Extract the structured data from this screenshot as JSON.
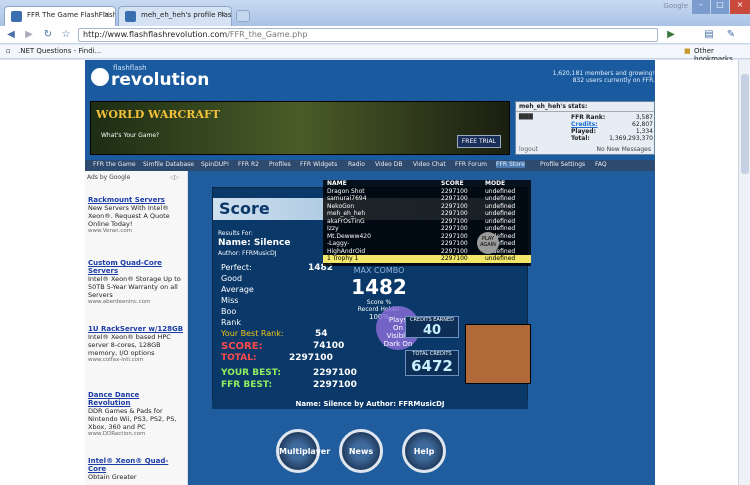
{
  "browser": {
    "tabs": [
      {
        "label": "FFR The Game FlashFlashR..."
      },
      {
        "label": "meh_eh_heh's profile FlashF..."
      }
    ],
    "google_label": "Google",
    "url_host": "http://www.flashflashrevolution.com",
    "url_path": "/FFR_the_Game.php",
    "bookmark": ".NET Questions - Findi...",
    "other_bookmarks": "Other bookmarks"
  },
  "site": {
    "logo_top": "flashflash",
    "logo_main": "revolution",
    "members_line": "1,620,181 members and growing!",
    "online_line": "832 users currently on FFR.",
    "banner_title": "WORLD WARCRAFT",
    "banner_sub": "What's Your Game?",
    "free_trial": "FREE TRIAL"
  },
  "user": {
    "title": "meh_eh_heh's stats:",
    "ffr_rank_label": "FFR Rank:",
    "ffr_rank": "3,587",
    "credits_label": "Credits:",
    "credits": "62,807",
    "played_label": "Played:",
    "played": "1,334",
    "total_label": "Total:",
    "total": "1,369,293,370",
    "logout": "logout",
    "messages": "No New Messages"
  },
  "menu": [
    "FFR the Game",
    "Simfile Database",
    "SpinDUP!",
    "FFR R2",
    "Profiles",
    "FFR Widgets",
    "Radio",
    "Video DB",
    "Video Chat",
    "FFR Forum",
    "FFR Store",
    "Profile Settings",
    "FAQ"
  ],
  "ads": {
    "header": "Ads by Google",
    "items": [
      {
        "title": "Rackmount Servers",
        "text": "New Servers With Intel® Xeon®. Request A Quote Online Today!",
        "url": "www.Veran.com"
      },
      {
        "title": "Custom Quad-Core Servers",
        "text": "Intel® Xeon® Storage Up to 50TB 5-Year Warranty on all Servers",
        "url": "www.aberdeeninc.com"
      },
      {
        "title": "1U RackServer w/128GB",
        "text": "Intel® Xeon® based HPC server 8-cores, 128GB memory, I/O options",
        "url": "www.colfax-intl.com"
      },
      {
        "title": "Dance Dance Revolution",
        "text": "DDR Games & Pads for Nintendo Wii, PS3, PS2, PS, Xbox, 360 and PC",
        "url": "www.DDRaction.com"
      },
      {
        "title": "Intel® Xeon® Quad-Core",
        "text": "Obtain Greater",
        "url": ""
      }
    ]
  },
  "game": {
    "header": "Score",
    "results_for": "Results For:",
    "name": "Name: Silence",
    "author": "Author: FFRMusicDJ",
    "perfect": "Perfect:",
    "perfect_val": "1482",
    "good": "Good",
    "average": "Average",
    "miss": "Miss",
    "boo": "Boo",
    "rank": "Rank",
    "best_rank": "Your Best Rank:",
    "best_rank_val": "54",
    "score_label": "SCORE:",
    "score_val": "74100",
    "total_label": "TOTAL:",
    "total_val": "2297100",
    "your_best_label": "YOUR BEST:",
    "your_best_val": "2297100",
    "ffr_best_label": "FFR BEST:",
    "ffr_best_val": "2297100",
    "max_combo": "MAX COMBO",
    "max_combo_val": "1482",
    "score_pct": "Score %",
    "record": "Record Holder",
    "record_pct": "100%",
    "plays": "Plays",
    "plays_on": "On",
    "visible": "Visible",
    "dark_on": "Dark On",
    "credits_earned": "CREDITS EARNED",
    "credits_earned_val": "40",
    "total_credits": "TOTAL CREDITS",
    "total_credits_val": "6472",
    "footer": "Name: Silence by Author: FFRMusicDJ",
    "play_again": "PLAY AGAIN",
    "buttons": [
      "Multiplayer",
      "News",
      "Help"
    ]
  },
  "scores": {
    "headers": [
      "NAME",
      "SCORE",
      "MODE"
    ],
    "rows": [
      {
        "name": "Dragon Shot",
        "score": "2297100",
        "mode": "undefined"
      },
      {
        "name": "samurai7694",
        "score": "2297100",
        "mode": "undefined"
      },
      {
        "name": "NekoGon",
        "score": "2297100",
        "mode": "undefined"
      },
      {
        "name": "meh_eh_heh",
        "score": "2297100",
        "mode": "undefined"
      },
      {
        "name": "akaFrOsTinG",
        "score": "2297100",
        "mode": "undefined"
      },
      {
        "name": "Izzy",
        "score": "2297100",
        "mode": "undefined"
      },
      {
        "name": "Mt.Dewww420",
        "score": "2297100",
        "mode": "undefined"
      },
      {
        "name": "-Laggy-",
        "score": "2297100",
        "mode": "undefined"
      },
      {
        "name": "HighAndrOid",
        "score": "2297100",
        "mode": "undefined"
      },
      {
        "name": "1 Trophy 1",
        "score": "2297100",
        "mode": "undefined"
      }
    ]
  }
}
